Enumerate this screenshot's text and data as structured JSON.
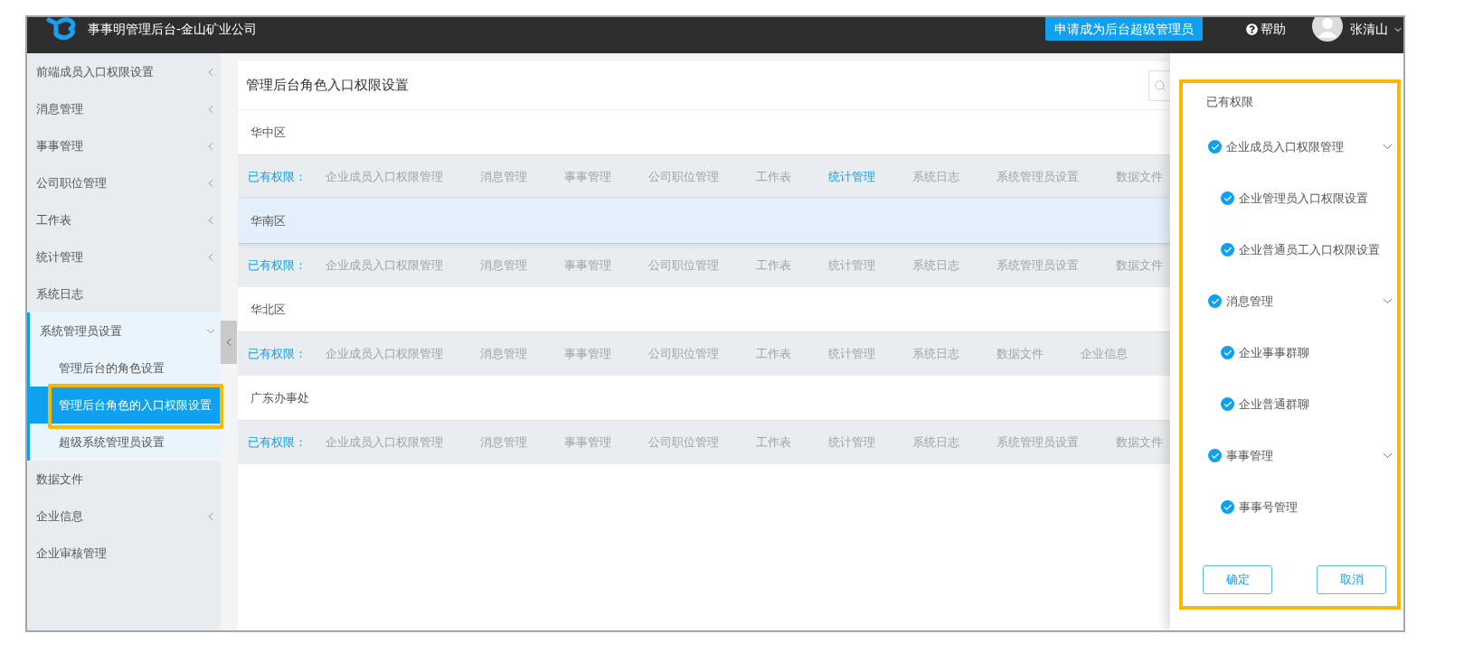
{
  "header": {
    "title": "事事明管理后台-金山矿业公司",
    "apply_button": "申请成为后台超级管理员",
    "help_link": "帮助",
    "user_name": "张清山"
  },
  "sidebar": {
    "items": [
      {
        "label": "前端成员入口权限设置",
        "expanded": false
      },
      {
        "label": "消息管理",
        "expanded": false
      },
      {
        "label": "事事管理",
        "expanded": false
      },
      {
        "label": "公司职位管理",
        "expanded": false
      },
      {
        "label": "工作表",
        "expanded": false
      },
      {
        "label": "统计管理",
        "expanded": false
      },
      {
        "label": "系统日志"
      },
      {
        "label": "系统管理员设置",
        "expanded": true,
        "children": [
          {
            "label": "管理后台的角色设置",
            "selected": false
          },
          {
            "label": "管理后台角色的入口权限设置",
            "selected": true
          },
          {
            "label": "超级系统管理员设置",
            "selected": false
          }
        ]
      },
      {
        "label": "数据文件"
      },
      {
        "label": "企业信息",
        "expanded": false
      },
      {
        "label": "企业审核管理"
      }
    ]
  },
  "page": {
    "title": "管理后台角色入口权限设置"
  },
  "regions": [
    {
      "name": "华中区",
      "highlighted": false,
      "permissions_label": "已有权限：",
      "permissions": [
        {
          "label": "企业成员入口权限管理",
          "highlighted": false
        },
        {
          "label": "消息管理",
          "highlighted": false
        },
        {
          "label": "事事管理",
          "highlighted": false
        },
        {
          "label": "公司职位管理",
          "highlighted": false
        },
        {
          "label": "工作表",
          "highlighted": false
        },
        {
          "label": "统计管理",
          "highlighted": true
        },
        {
          "label": "系统日志",
          "highlighted": false
        },
        {
          "label": "系统管理员设置",
          "highlighted": false
        },
        {
          "label": "数据文件",
          "highlighted": false
        }
      ]
    },
    {
      "name": "华南区",
      "highlighted": true,
      "permissions_label": "已有权限：",
      "permissions": [
        {
          "label": "企业成员入口权限管理",
          "highlighted": false
        },
        {
          "label": "消息管理",
          "highlighted": false
        },
        {
          "label": "事事管理",
          "highlighted": false
        },
        {
          "label": "公司职位管理",
          "highlighted": false
        },
        {
          "label": "工作表",
          "highlighted": false
        },
        {
          "label": "统计管理",
          "highlighted": false
        },
        {
          "label": "系统日志",
          "highlighted": false
        },
        {
          "label": "系统管理员设置",
          "highlighted": false
        },
        {
          "label": "数据文件",
          "highlighted": false
        }
      ]
    },
    {
      "name": "华北区",
      "highlighted": false,
      "permissions_label": "已有权限：",
      "permissions": [
        {
          "label": "企业成员入口权限管理",
          "highlighted": false
        },
        {
          "label": "消息管理",
          "highlighted": false
        },
        {
          "label": "事事管理",
          "highlighted": false
        },
        {
          "label": "公司职位管理",
          "highlighted": false
        },
        {
          "label": "工作表",
          "highlighted": false
        },
        {
          "label": "统计管理",
          "highlighted": false
        },
        {
          "label": "系统日志",
          "highlighted": false
        },
        {
          "label": "数据文件",
          "highlighted": false
        },
        {
          "label": "企业信息",
          "highlighted": false
        }
      ]
    },
    {
      "name": "广东办事处",
      "highlighted": false,
      "permissions_label": "已有权限：",
      "permissions": [
        {
          "label": "企业成员入口权限管理",
          "highlighted": false
        },
        {
          "label": "消息管理",
          "highlighted": false
        },
        {
          "label": "事事管理",
          "highlighted": false
        },
        {
          "label": "公司职位管理",
          "highlighted": false
        },
        {
          "label": "工作表",
          "highlighted": false
        },
        {
          "label": "统计管理",
          "highlighted": false
        },
        {
          "label": "系统日志",
          "highlighted": false
        },
        {
          "label": "系统管理员设置",
          "highlighted": false
        },
        {
          "label": "数据文件",
          "highlighted": false
        }
      ]
    }
  ],
  "permission_panel": {
    "title": "已有权限",
    "tree": [
      {
        "label": "企业成员入口权限管理",
        "checked": true,
        "expanded": true,
        "children": [
          {
            "label": "企业管理员入口权限设置",
            "checked": true
          },
          {
            "label": "企业普通员工入口权限设置",
            "checked": true
          }
        ]
      },
      {
        "label": "消息管理",
        "checked": true,
        "expanded": true,
        "children": [
          {
            "label": "企业事事群聊",
            "checked": true
          },
          {
            "label": "企业普通群聊",
            "checked": true
          }
        ]
      },
      {
        "label": "事事管理",
        "checked": true,
        "expanded": true,
        "children": [
          {
            "label": "事事号管理",
            "checked": true
          }
        ]
      }
    ],
    "buttons": [
      "确定",
      "取消"
    ]
  }
}
